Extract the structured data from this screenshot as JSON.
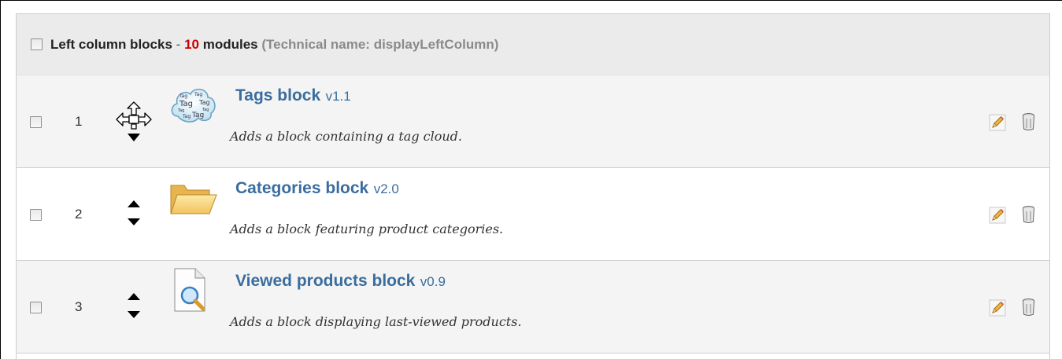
{
  "hook": {
    "title": "Left column blocks",
    "separator": "-",
    "count": "10",
    "count_unit": "modules",
    "technical_name": "(Technical name: displayLeftColumn)"
  },
  "modules": [
    {
      "position": "1",
      "name": "Tags block",
      "version": "v1.1",
      "description": "Adds a block containing a tag cloud.",
      "icon": "tag-cloud-icon",
      "handle": "drag-move-icon"
    },
    {
      "position": "2",
      "name": "Categories block",
      "version": "v2.0",
      "description": "Adds a block featuring product categories.",
      "icon": "folder-icon",
      "handle": "move-up-down-icon"
    },
    {
      "position": "3",
      "name": "Viewed products block",
      "version": "v0.9",
      "description": "Adds a block displaying last-viewed products.",
      "icon": "document-search-icon",
      "handle": "move-up-down-icon"
    }
  ],
  "actions": {
    "edit_icon": "pencil-icon",
    "delete_icon": "trash-icon"
  },
  "colors": {
    "link": "#3a6d9e",
    "count": "#cc0000",
    "header_bg": "#ebebeb",
    "odd_row_bg": "#f4f4f4"
  }
}
